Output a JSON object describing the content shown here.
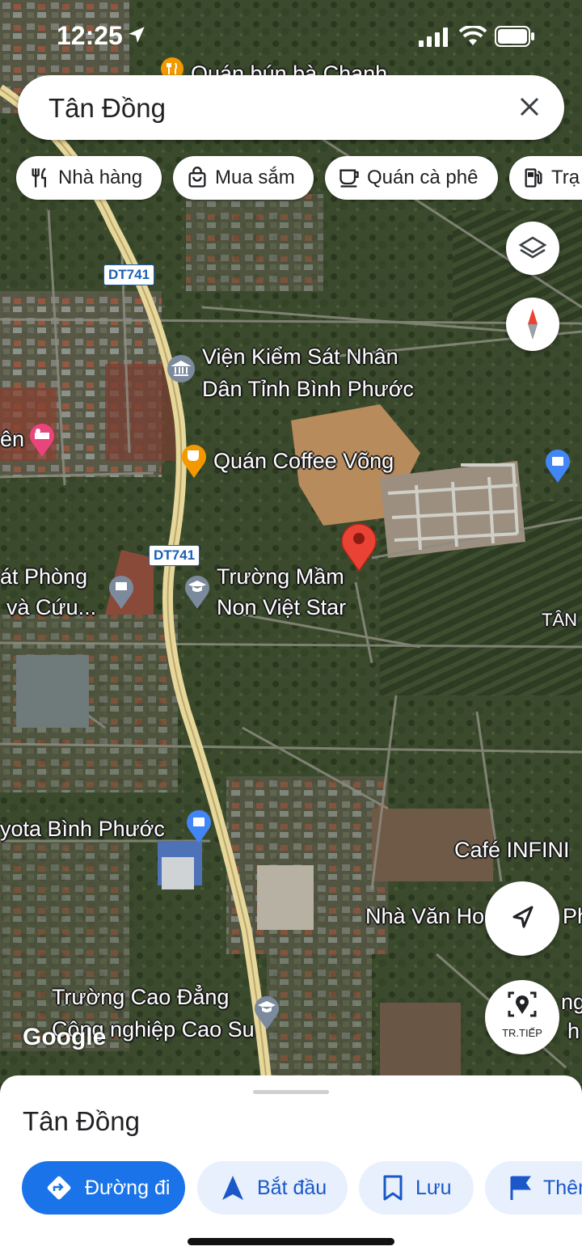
{
  "status": {
    "time": "12:25"
  },
  "search": {
    "query": "Tân Đồng"
  },
  "chips": [
    {
      "label": "Nhà hàng",
      "icon": "restaurant-icon"
    },
    {
      "label": "Mua sắm",
      "icon": "shopping-bag-icon"
    },
    {
      "label": "Quán cà phê",
      "icon": "coffee-icon"
    },
    {
      "label": "Trạ",
      "icon": "gas-station-icon"
    }
  ],
  "map": {
    "road_shield_1": "DT741",
    "road_shield_2": "DT741",
    "labels": {
      "top_cut": "Quán bún bà Chanh",
      "vks_1": "Viện Kiểm Sát Nhân",
      "vks_2": "Dân Tỉnh Bình Phước",
      "left_hotel": "ên",
      "coffee": "Quán Coffee Võng",
      "phong_1": "át Phòng",
      "phong_2": "và Cứu...",
      "school_1": "Trường Mầm",
      "school_2": "Non Việt Star",
      "tan": "TÂN",
      "toyota": "yota Bình Phước",
      "cafe_inf": "Café INFINI",
      "nha_van": "Nhà Văn Ho",
      "ph": "Ph",
      "college_1": "Trường Cao Đẳng",
      "college_2": "Công nghiệp Cao Su",
      "ng": "ng",
      "h": "h"
    },
    "watermark": "Google",
    "recenter_label": "TR.TIẾP"
  },
  "sheet": {
    "title": "Tân Đồng",
    "actions": [
      {
        "label": "Đường đi",
        "icon": "directions-icon"
      },
      {
        "label": "Bắt đầu",
        "icon": "navigation-arrow-icon"
      },
      {
        "label": "Lưu",
        "icon": "bookmark-icon"
      },
      {
        "label": "Thêm",
        "icon": "flag-icon"
      }
    ]
  },
  "colors": {
    "accent": "#1a73e8",
    "pin": "#ea4335",
    "road": "#e7d79a"
  }
}
